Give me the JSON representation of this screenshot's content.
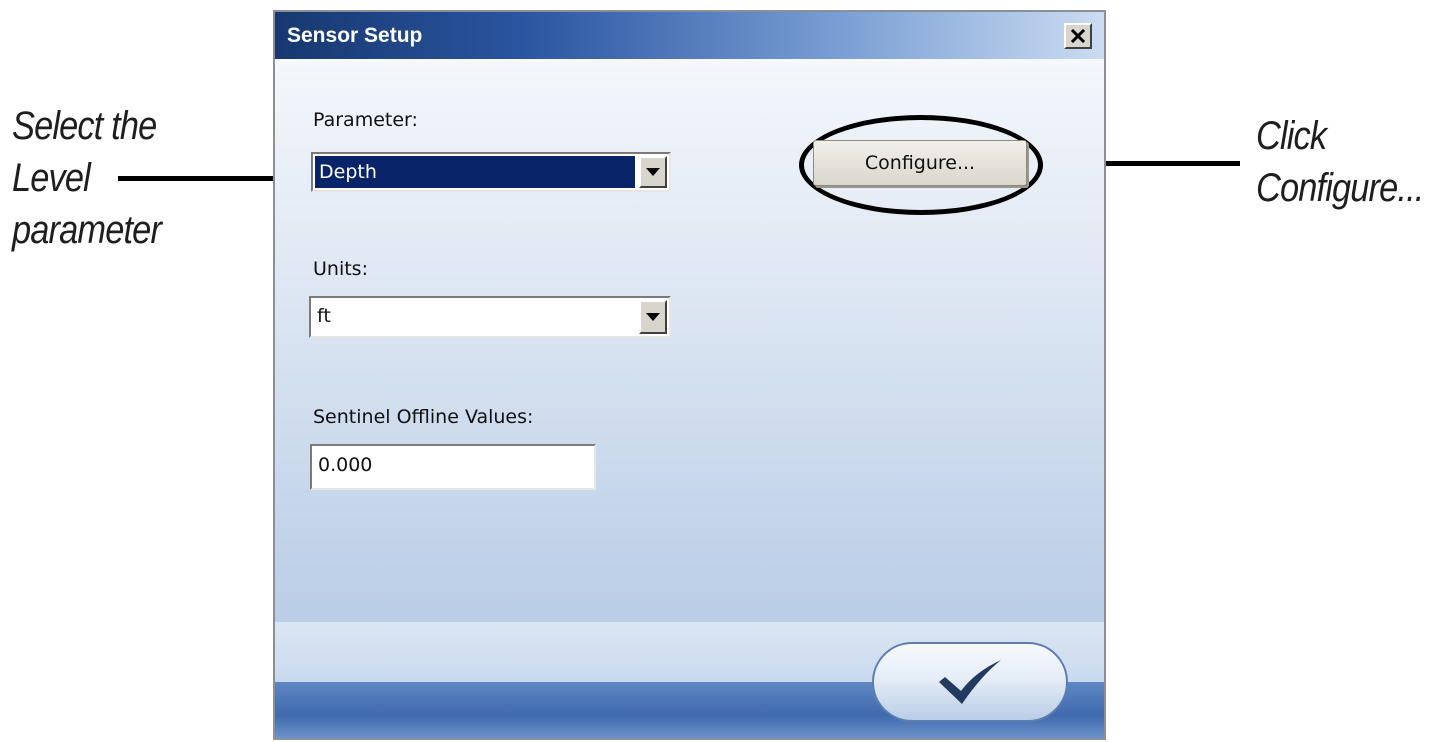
{
  "annotations": {
    "left": [
      "Select the",
      "Level",
      "parameter"
    ],
    "right": [
      "Click",
      "Configure..."
    ]
  },
  "dialog": {
    "title": "Sensor Setup",
    "parameter_label": "Parameter:",
    "parameter_value": "Depth",
    "units_label": "Units:",
    "units_value": "ft",
    "offline_label": "Sentinel Offline Values:",
    "offline_value": "0.000",
    "configure_label": "Configure..."
  },
  "icons": {
    "close": "close-icon",
    "dropdown": "chevron-down-icon",
    "ok": "checkmark-icon"
  },
  "colors": {
    "title_bar_dark": "#17386f",
    "selection": "#0a246a",
    "footer": "#3f6aad"
  }
}
